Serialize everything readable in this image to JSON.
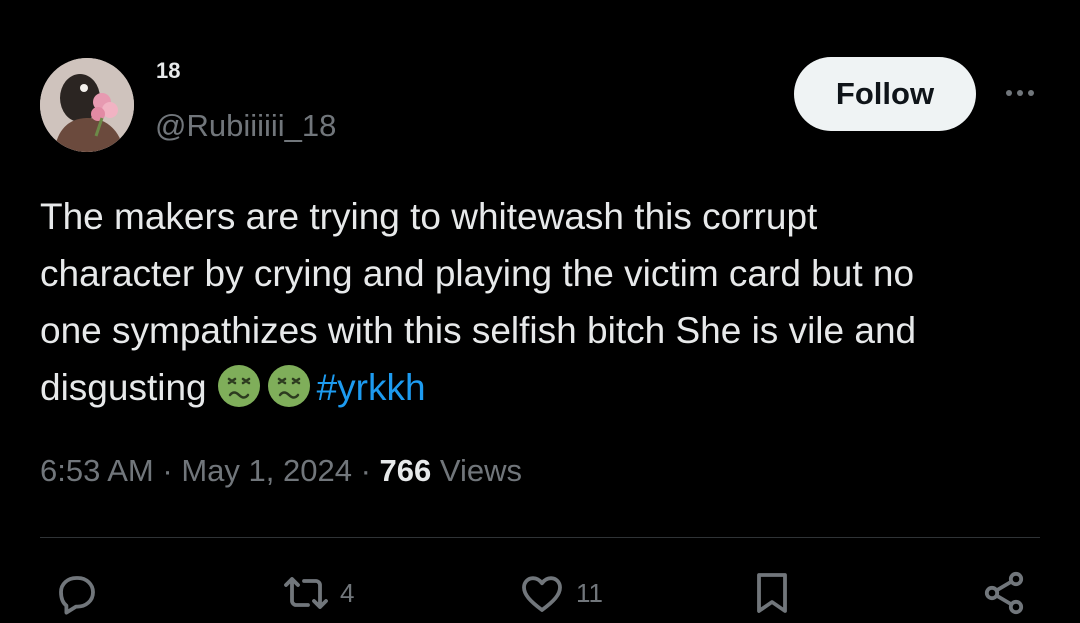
{
  "user": {
    "display_name": "18",
    "handle": "@Rubiiiiii_18",
    "avatar": "avatar"
  },
  "follow_button": {
    "label": "Follow"
  },
  "more_menu": {
    "icon": "more-horizontal-icon"
  },
  "tweet": {
    "text_lines": [
      "The makers are trying to whitewash this corrupt",
      "character by crying and playing the victim card but no",
      "one sympathizes with this selfish bitch She is vile and",
      "disgusting"
    ],
    "emojis": [
      "nauseated-face-emoji",
      "nauseated-face-emoji"
    ],
    "hashtag": "#yrkkh",
    "hashtag_color": "#1d9bf0"
  },
  "meta": {
    "time": "6:53 AM",
    "separator": "·",
    "date": "May 1, 2024",
    "views_count": "766",
    "views_label": "Views"
  },
  "actions": {
    "reply": {
      "icon": "reply-icon"
    },
    "retweet": {
      "icon": "retweet-icon",
      "count": "4"
    },
    "like": {
      "icon": "heart-icon",
      "count": "11"
    },
    "bookmark": {
      "icon": "bookmark-icon"
    },
    "share": {
      "icon": "share-icon"
    }
  }
}
